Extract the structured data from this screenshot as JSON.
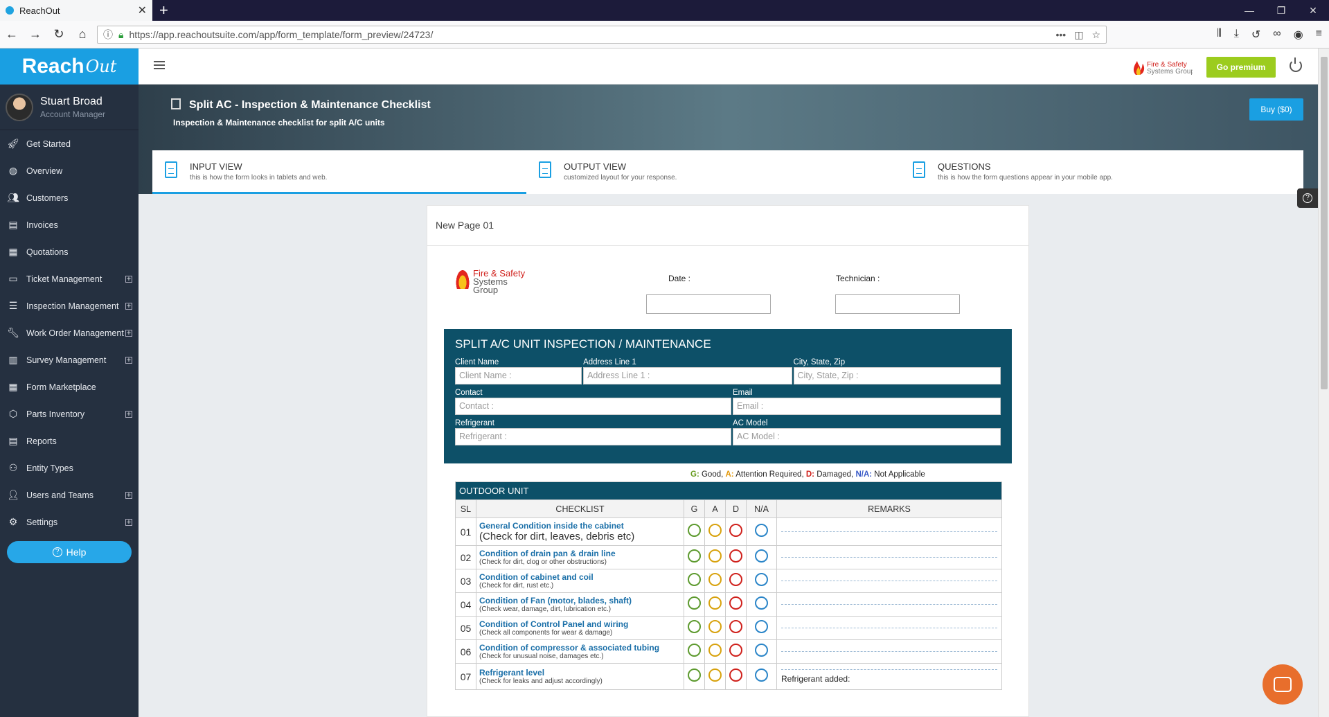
{
  "browser": {
    "tab_title": "ReachOut",
    "url": "https://app.reachoutsuite.com/app/form_template/form_preview/24723/"
  },
  "app": {
    "logo_text": "Reach",
    "logo_script": "Out",
    "user_name": "Stuart Broad",
    "user_role": "Account Manager",
    "menu": [
      {
        "label": "Get Started",
        "icon": "rocket-icon",
        "expand": false
      },
      {
        "label": "Overview",
        "icon": "globe-icon",
        "expand": false
      },
      {
        "label": "Customers",
        "icon": "users-icon",
        "expand": false
      },
      {
        "label": "Invoices",
        "icon": "invoice-icon",
        "expand": false
      },
      {
        "label": "Quotations",
        "icon": "quotation-icon",
        "expand": false
      },
      {
        "label": "Ticket Management",
        "icon": "monitor-icon",
        "expand": true
      },
      {
        "label": "Inspection Management",
        "icon": "checklist-icon",
        "expand": true
      },
      {
        "label": "Work Order Management",
        "icon": "wrench-icon",
        "expand": true
      },
      {
        "label": "Survey Management",
        "icon": "survey-icon",
        "expand": true
      },
      {
        "label": "Form Marketplace",
        "icon": "form-icon",
        "expand": false
      },
      {
        "label": "Parts Inventory",
        "icon": "box-icon",
        "expand": true
      },
      {
        "label": "Reports",
        "icon": "reports-icon",
        "expand": false
      },
      {
        "label": "Entity Types",
        "icon": "entity-icon",
        "expand": false
      },
      {
        "label": "Users and Teams",
        "icon": "user-icon",
        "expand": true
      },
      {
        "label": "Settings",
        "icon": "gear-icon",
        "expand": true
      }
    ],
    "help_label": "Help",
    "go_premium": "Go premium",
    "brand_line1": "Fire & Safety",
    "brand_line2": "Systems Group"
  },
  "hero": {
    "title": "Split AC - Inspection & Maintenance Checklist",
    "subtitle": "Inspection & Maintenance checklist for split A/C units",
    "buy_label": "Buy ($0)"
  },
  "view_tabs": [
    {
      "label": "INPUT VIEW",
      "desc": "this is how the form looks in tablets and web."
    },
    {
      "label": "OUTPUT VIEW",
      "desc": "customized layout for your response."
    },
    {
      "label": "QUESTIONS",
      "desc": "this is how the form questions appear in your mobile app."
    }
  ],
  "form": {
    "page_title": "New Page 01",
    "date_label": "Date :",
    "technician_label": "Technician :",
    "banner_title": "SPLIT A/C UNIT INSPECTION / MAINTENANCE",
    "fields": {
      "client_name_label": "Client Name",
      "client_name_ph": "Client Name :",
      "address_label": "Address Line 1",
      "address_ph": "Address Line 1 :",
      "city_label": "City, State, Zip",
      "city_ph": "City, State, Zip :",
      "contact_label": "Contact",
      "contact_ph": "Contact :",
      "email_label": "Email",
      "email_ph": "Email :",
      "refrigerant_label": "Refrigerant",
      "refrigerant_ph": "Refrigerant :",
      "acmodel_label": "AC Model",
      "acmodel_ph": "AC Model :"
    },
    "legend": {
      "g": "G:",
      "g_text": " Good, ",
      "a": "A:",
      "a_text": " Attention Required, ",
      "d": "D:",
      "d_text": " Damaged, ",
      "n": "N/A:",
      "n_text": " Not Applicable"
    },
    "section_title": "OUTDOOR UNIT",
    "columns": {
      "sl": "SL",
      "checklist": "CHECKLIST",
      "g": "G",
      "a": "A",
      "d": "D",
      "na": "N/A",
      "remarks": "REMARKS"
    },
    "items": [
      {
        "sl": "01",
        "main": "General Condition inside the cabinet",
        "sub": "(Check for dirt, leaves, debris etc)"
      },
      {
        "sl": "02",
        "main": "Condition of drain pan & drain line",
        "sub": "(Check for dirt, clog or other obstructions)"
      },
      {
        "sl": "03",
        "main": "Condition of cabinet and coil",
        "sub": "(Check for dirt, rust etc.)"
      },
      {
        "sl": "04",
        "main": "Condition of Fan (motor, blades, shaft)",
        "sub": "(Check wear, damage, dirt, lubrication etc.)"
      },
      {
        "sl": "05",
        "main": "Condition of Control Panel and wiring",
        "sub": "(Check all components for wear & damage)"
      },
      {
        "sl": "06",
        "main": "Condition of compressor & associated tubing",
        "sub": "(Check for unusual noise, damages etc.)"
      },
      {
        "sl": "07",
        "main": "Refrigerant level",
        "sub": "(Check for leaks and adjust accordingly)"
      }
    ],
    "refrigerant_added": "Refrigerant added:"
  }
}
